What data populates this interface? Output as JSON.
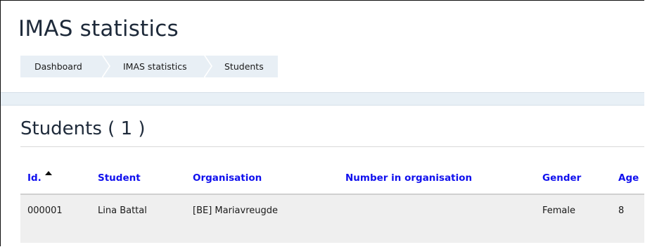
{
  "header": {
    "title": "IMAS statistics",
    "breadcrumb": [
      "Dashboard",
      "IMAS statistics",
      "Students"
    ]
  },
  "section": {
    "title": "Students ( 1 )"
  },
  "table": {
    "columns": [
      "Id.",
      "Student",
      "Organisation",
      "Number in organisation",
      "Gender",
      "Age"
    ],
    "sorted_column": "Id.",
    "sort_direction": "ascending",
    "rows": [
      {
        "id": "000001",
        "student": "Lina Battal",
        "organisation": "[BE] Mariavreugde",
        "number_in_organisation": "",
        "gender": "Female",
        "age": "8"
      }
    ]
  },
  "colors": {
    "link": "#1010ee",
    "breadcrumb_bg": "#e8eff5",
    "row_bg": "#efefef",
    "band_bg": "#e8f0f6"
  },
  "icons": {
    "sort": "caret-up-icon"
  }
}
